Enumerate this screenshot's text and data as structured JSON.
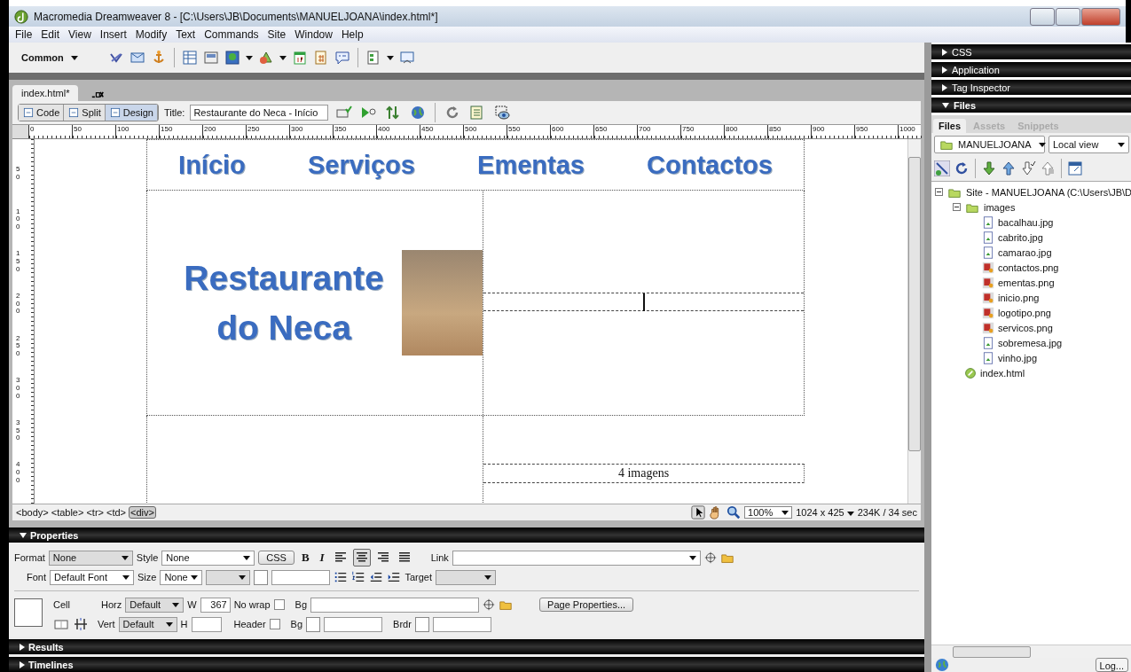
{
  "window": {
    "title": "Macromedia Dreamweaver 8 - [C:\\Users\\JB\\Documents\\MANUELJOANA\\index.html*]"
  },
  "menu": [
    "File",
    "Edit",
    "View",
    "Insert",
    "Modify",
    "Text",
    "Commands",
    "Site",
    "Window",
    "Help"
  ],
  "insert_bar": {
    "category": "Common"
  },
  "document": {
    "tab": "index.html*",
    "views": [
      {
        "label": "Code",
        "selected": false
      },
      {
        "label": "Split",
        "selected": false
      },
      {
        "label": "Design",
        "selected": true
      }
    ],
    "title_label": "Title:",
    "title_value": "Restaurante do Neca - Início",
    "ruler": [
      "0",
      "50",
      "100",
      "150",
      "200",
      "250",
      "300",
      "350",
      "400",
      "450",
      "500",
      "550",
      "600",
      "650",
      "700",
      "750",
      "800",
      "850",
      "900",
      "950",
      "1000"
    ],
    "vruler": [
      "50",
      "100",
      "150",
      "200",
      "250",
      "300",
      "350",
      "400"
    ],
    "page": {
      "nav": [
        "Início",
        "Serviços",
        "Ementas",
        "Contactos"
      ],
      "logo_text": "Restaurante do Neca",
      "caption": "4 imagens"
    },
    "tags": [
      {
        "label": "<body>",
        "selected": false
      },
      {
        "label": "<table>",
        "selected": false
      },
      {
        "label": "<tr>",
        "selected": false
      },
      {
        "label": "<td>",
        "selected": false
      },
      {
        "label": "<div>",
        "selected": true
      }
    ],
    "zoom": "100%",
    "window_size": "1024 x 425",
    "download": "234K / 34 sec"
  },
  "properties": {
    "title": "Properties",
    "expanded": true,
    "format_label": "Format",
    "format": "None",
    "style_label": "Style",
    "style": "None",
    "css": "CSS",
    "bold": "B",
    "italic": "I",
    "alignments": [
      {
        "kind": "left",
        "selected": false
      },
      {
        "kind": "center",
        "selected": true
      },
      {
        "kind": "right",
        "selected": false
      },
      {
        "kind": "justify",
        "selected": false
      }
    ],
    "link_label": "Link",
    "font_label": "Font",
    "font": "Default Font",
    "size_label": "Size",
    "size": "None",
    "target_label": "Target",
    "cell_label": "Cell",
    "horz_label": "Horz",
    "horz": "Default",
    "w_label": "W",
    "w": "367",
    "nowrap_label": "No wrap",
    "nowrap": false,
    "bg_label": "Bg",
    "page_properties": "Page Properties...",
    "vert_label": "Vert",
    "vert": "Default",
    "h_label": "H",
    "header_label": "Header",
    "header": false,
    "bg2_label": "Bg",
    "brdr_label": "Brdr"
  },
  "bottom_panels": [
    {
      "title": "Results",
      "expanded": false
    },
    {
      "title": "Timelines",
      "expanded": false
    }
  ],
  "side_panels": [
    {
      "title": "CSS",
      "expanded": false
    },
    {
      "title": "Application",
      "expanded": false
    },
    {
      "title": "Tag Inspector",
      "expanded": false
    },
    {
      "title": "Files",
      "expanded": true
    }
  ],
  "files": {
    "tabs": [
      {
        "label": "Files",
        "selected": true
      },
      {
        "label": "Assets",
        "selected": false
      },
      {
        "label": "Snippets",
        "selected": false
      }
    ],
    "site": "MANUELJOANA",
    "view": "Local view",
    "tree": [
      {
        "kind": "site",
        "label": "Site - MANUELJOANA (C:\\Users\\JB\\D",
        "expanded": true,
        "children": [
          {
            "kind": "folder",
            "label": "images",
            "expanded": true,
            "children": [
              {
                "kind": "jpg",
                "label": "bacalhau.jpg"
              },
              {
                "kind": "jpg",
                "label": "cabrito.jpg"
              },
              {
                "kind": "jpg",
                "label": "camarao.jpg"
              },
              {
                "kind": "png",
                "label": "contactos.png"
              },
              {
                "kind": "png",
                "label": "ementas.png"
              },
              {
                "kind": "png",
                "label": "inicio.png"
              },
              {
                "kind": "png",
                "label": "logotipo.png"
              },
              {
                "kind": "png",
                "label": "servicos.png"
              },
              {
                "kind": "jpg",
                "label": "sobremesa.jpg"
              },
              {
                "kind": "jpg",
                "label": "vinho.jpg"
              }
            ]
          },
          {
            "kind": "html",
            "label": "index.html"
          }
        ]
      }
    ],
    "log_button": "Log..."
  }
}
